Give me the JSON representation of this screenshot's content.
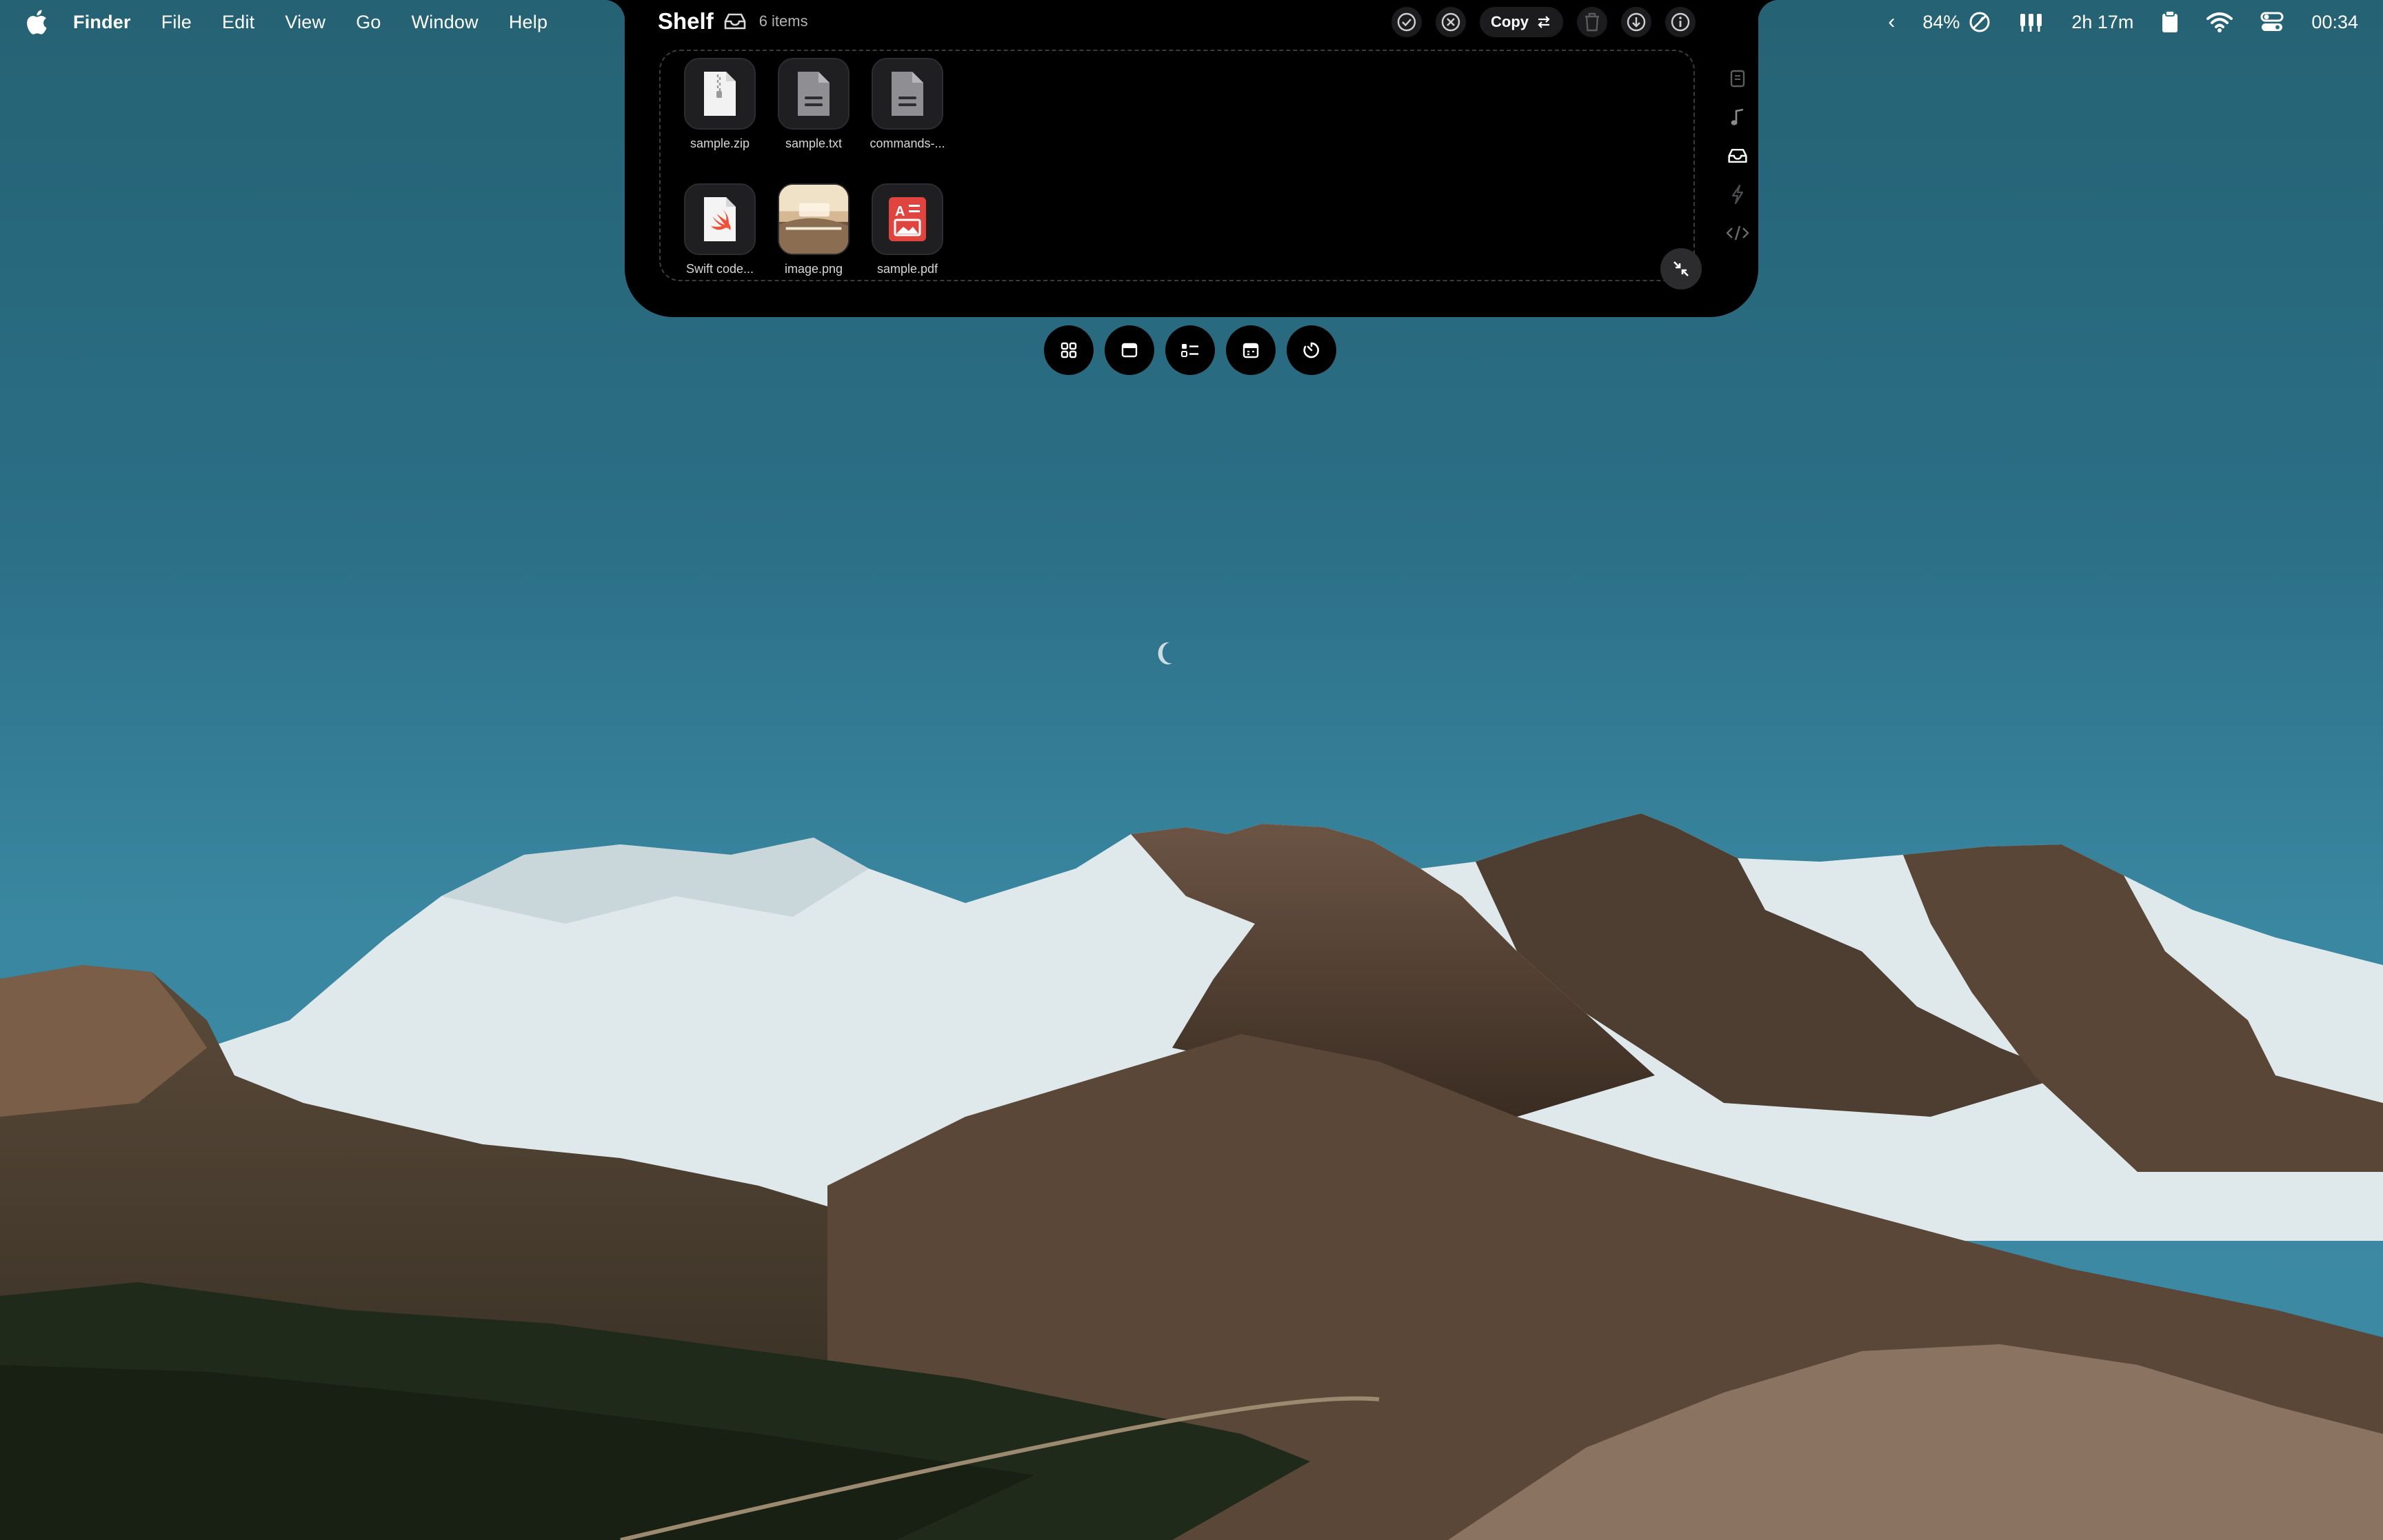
{
  "menubar": {
    "apple_icon": "apple-logo-icon",
    "app_name": "Finder",
    "menus": [
      "File",
      "Edit",
      "View",
      "Go",
      "Window",
      "Help"
    ],
    "status": {
      "battery_percent": "84%",
      "time_remaining": "2h 17m",
      "clock": "00:34",
      "chevron": "‹"
    }
  },
  "shelf": {
    "title": "Shelf",
    "item_count": "6 items",
    "copy_label": "Copy",
    "items": [
      {
        "name": "sample.zip",
        "icon": "zip-file-icon"
      },
      {
        "name": "sample.txt",
        "icon": "text-file-icon"
      },
      {
        "name": "commands-...",
        "icon": "text-file-icon"
      },
      {
        "name": "Swift code...",
        "icon": "swift-file-icon"
      },
      {
        "name": "image.png",
        "icon": "image-thumbnail"
      },
      {
        "name": "sample.pdf",
        "icon": "pdf-file-icon"
      }
    ]
  },
  "colors": {
    "panel": "#000000",
    "accent_pdf": "#e0443e",
    "sky": "#2b6f86"
  }
}
